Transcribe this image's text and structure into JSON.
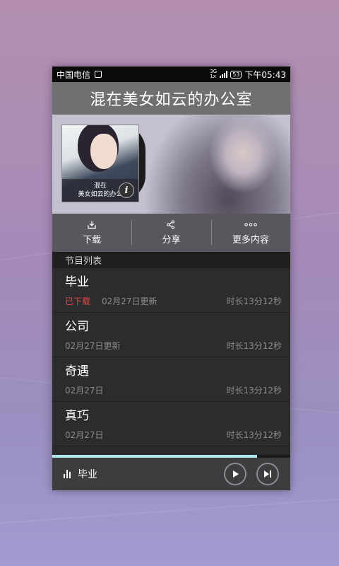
{
  "status_bar": {
    "carrier": "中国电信",
    "network_top": "3G",
    "network_bottom": "1x",
    "battery": "53",
    "time": "下午05:43"
  },
  "header": {
    "title": "混在美女如云的办公室"
  },
  "album": {
    "caption_line1": "混在",
    "caption_line2": "美女如云的办公",
    "info_icon": "info-icon"
  },
  "actions": [
    {
      "label": "下载",
      "icon": "download-icon"
    },
    {
      "label": "分享",
      "icon": "share-icon"
    },
    {
      "label": "更多内容",
      "icon": "more-icon"
    }
  ],
  "section": {
    "title": "节目列表"
  },
  "episodes": [
    {
      "title": "毕业",
      "download_status": "已下载",
      "date": "02月27日更新",
      "duration": "时长13分12秒"
    },
    {
      "title": "公司",
      "download_status": "",
      "date": "02月27日更新",
      "duration": "时长13分12秒"
    },
    {
      "title": "奇遇",
      "download_status": "",
      "date": "02月27日",
      "duration": "时长13分12秒"
    },
    {
      "title": "真巧",
      "download_status": "",
      "date": "02月27日",
      "duration": "时长13分12秒"
    }
  ],
  "player": {
    "now_playing": "毕业",
    "progress": 0.86,
    "play_icon": "play-icon",
    "next_icon": "next-icon"
  },
  "colors": {
    "accent": "#aee6f0",
    "downloaded": "#e34a43"
  }
}
